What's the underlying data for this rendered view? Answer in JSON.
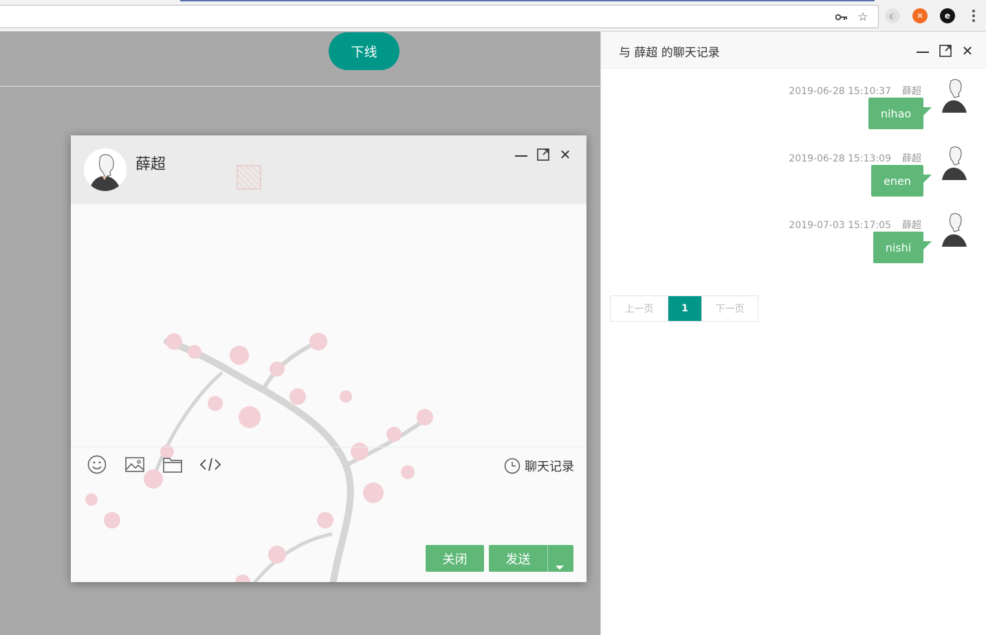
{
  "browser": {
    "icons": [
      "key-icon",
      "star-icon"
    ],
    "extensions": [
      "extension-icon",
      "extension-orange-icon",
      "extension-black-icon"
    ]
  },
  "page": {
    "offline_button": "下线"
  },
  "chat_window": {
    "contact_name": "薛超",
    "toolbar": {
      "history_label": "聊天记录"
    },
    "close_label": "关闭",
    "send_label": "发送"
  },
  "history": {
    "title": "与 薛超 的聊天记录",
    "messages": [
      {
        "time": "2019-06-28 15:10:37",
        "sender": "薛超",
        "text": "nihao"
      },
      {
        "time": "2019-06-28 15:13:09",
        "sender": "薛超",
        "text": "enen"
      },
      {
        "time": "2019-07-03 15:17:05",
        "sender": "薛超",
        "text": "nishi"
      }
    ],
    "pager": {
      "prev": "上一页",
      "current": "1",
      "next": "下一页"
    }
  },
  "colors": {
    "primary": "#009688",
    "bubble": "#5fb878",
    "overlay": "#a9a9a9"
  }
}
